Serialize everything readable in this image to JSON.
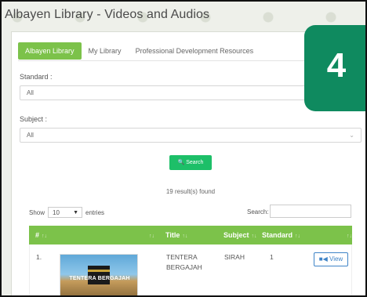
{
  "window": {
    "title": "Albayen Library - Videos and Audios"
  },
  "tabs": [
    {
      "label": "Albayen Library",
      "active": true
    },
    {
      "label": "My Library",
      "active": false
    },
    {
      "label": "Professional Development Resources",
      "active": false
    }
  ],
  "filters": {
    "standard": {
      "label": "Standard :",
      "value": "All"
    },
    "subject": {
      "label": "Subject :",
      "value": "All"
    }
  },
  "search_button": {
    "icon": "search-icon",
    "label": "Search"
  },
  "results_text": "19 result(s) found",
  "table_controls": {
    "show_label": "Show",
    "entries_value": "10",
    "entries_label": "entries",
    "search_label": "Search:"
  },
  "table": {
    "headers": [
      "#",
      "Title",
      "Subject",
      "Standard"
    ],
    "rows": [
      {
        "number": "1.",
        "thumbnail_text": "TENTERA BERGAJAH",
        "title": "TENTERA BERGAJAH",
        "subject": "SIRAH",
        "standard": "1",
        "action": "View"
      }
    ]
  },
  "badge": {
    "value": "4"
  },
  "colors": {
    "accent_green": "#7cc24a",
    "search_green": "#1dbf68",
    "badge_green": "#0f8a5f",
    "view_blue": "#3f84c7"
  }
}
